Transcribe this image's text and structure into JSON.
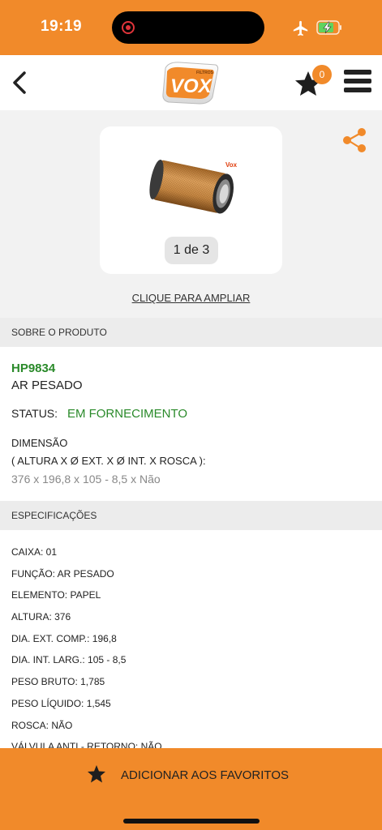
{
  "status_bar": {
    "time": "19:19"
  },
  "header": {
    "logo_text": "VOX",
    "logo_subtext": "FILTROS",
    "favorites_count": "0"
  },
  "gallery": {
    "image_brand": "Vox",
    "counter": "1 de 3",
    "zoom_link": "CLIQUE PARA AMPLIAR"
  },
  "sections": {
    "about_title": "SOBRE O PRODUTO",
    "specs_title": "ESPECIFICAÇÕES"
  },
  "product": {
    "code": "HP9834",
    "name": "AR PESADO",
    "status_label": "STATUS:",
    "status_value": "EM FORNECIMENTO",
    "dimension_title": "DIMENSÃO",
    "dimension_format": "( ALTURA X Ø EXT. X Ø INT. X ROSCA ):",
    "dimension_value": "376 x 196,8 x 105 - 8,5 x Não"
  },
  "specs": [
    "CAIXA: 01",
    "FUNÇÃO: AR PESADO",
    "ELEMENTO: PAPEL",
    "ALTURA: 376",
    "DIA. EXT. COMP.: 196,8",
    "DIA. INT. LARG.: 105 - 8,5",
    "PESO BRUTO: 1,785",
    "PESO LÍQUIDO: 1,545",
    "ROSCA: NÃO",
    "VÁLVULA ANTI - RETORNO: NÃO"
  ],
  "bottom_bar": {
    "label": "ADICIONAR AOS FAVORITOS"
  },
  "colors": {
    "accent": "#f18a2a",
    "status_green": "#2a8a2a"
  }
}
